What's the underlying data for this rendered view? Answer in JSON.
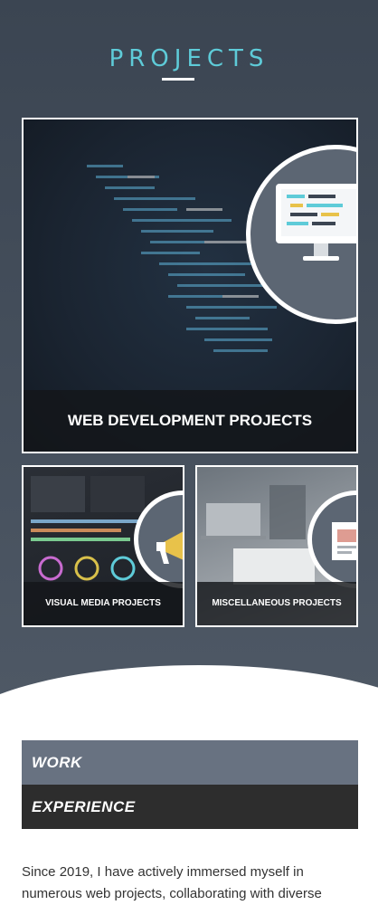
{
  "projects": {
    "title": "PROJECTS",
    "cards": {
      "web": "WEB DEVELOPMENT PROJECTS",
      "visual": "VISUAL MEDIA PROJECTS",
      "misc": "MISCELLANEOUS PROJECTS"
    },
    "icons": {
      "web": "monitor-code-icon",
      "visual": "megaphone-icon",
      "misc": "document-icon"
    }
  },
  "info": {
    "work_label": "WORK",
    "experience_label": "EXPERIENCE"
  },
  "bio": {
    "text": "Since 2019, I have actively immersed myself in numerous web projects, collaborating with diverse"
  },
  "colors": {
    "accent": "#5ecbd8",
    "section_bg": "#3b4552",
    "work_bar": "#687281",
    "experience_bar": "#2d2d2d"
  }
}
